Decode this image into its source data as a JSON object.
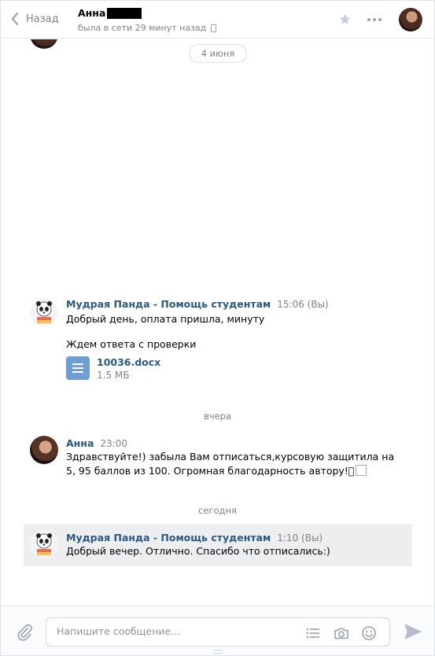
{
  "header": {
    "back_label": "Назад",
    "peer_name": "Анна",
    "peer_status": "была в сети 29 минут назад"
  },
  "chat": {
    "date_pill": "4 июня",
    "separators": {
      "yesterday": "вчера",
      "today": "сегодня"
    },
    "messages": [
      {
        "author": "Мудрая Панда - Помощь студентам",
        "time": "15:06",
        "suffix": "(Вы)",
        "lines": [
          "Добрый день, оплата пришла, минуту",
          "Ждем ответа с проверки"
        ],
        "attachment": {
          "name": "10036.docx",
          "size": "1.5 МБ",
          "icon": "document-icon"
        }
      },
      {
        "author": "Анна",
        "time": "23:00",
        "lines": [
          "Здравствуйте!) забыла Вам отписаться,курсовую защитила на",
          "5, 95 баллов из 100. Огромная благодарность автору!"
        ],
        "trailing_glyph": "⃞"
      },
      {
        "author": "Мудрая Панда - Помощь студентам",
        "time": "1:10",
        "suffix": "(Вы)",
        "lines": [
          "Добрый вечер. Отлично. Спасибо что отписались:)"
        ]
      }
    ]
  },
  "composer": {
    "placeholder": "Напишите сообщение..."
  },
  "colors": {
    "link": "#2a5885",
    "muted": "#828282",
    "accent": "#6d9fd5",
    "highlight_bg": "#edeef0"
  }
}
